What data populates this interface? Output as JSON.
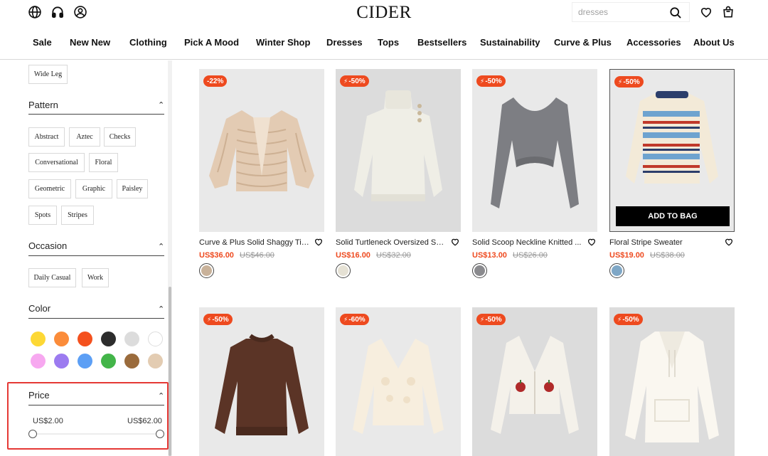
{
  "brand": {
    "logo": "CIDER"
  },
  "search": {
    "placeholder": "dresses"
  },
  "nav": [
    "Sale",
    "New New",
    "Clothing",
    "Pick A Mood",
    "Winter Shop",
    "Dresses",
    "Tops",
    "Bestsellers",
    "Sustainability",
    "Curve & Plus",
    "Accessories",
    "About Us"
  ],
  "filters": {
    "style_chip": "Wide Leg",
    "pattern": {
      "title": "Pattern",
      "options": [
        "Abstract",
        "Aztec",
        "Checks",
        "Conversational",
        "Floral",
        "Geometric",
        "Graphic",
        "Paisley",
        "Spots",
        "Stripes"
      ]
    },
    "occasion": {
      "title": "Occasion",
      "options": [
        "Daily Casual",
        "Work"
      ]
    },
    "color": {
      "title": "Color",
      "swatches": [
        "#fdd835",
        "#fb8c3a",
        "#f4511e",
        "#2d2d2d",
        "#dcdcdc",
        "#ffffff",
        "#f7a8f0",
        "#9c7bf0",
        "#5c9ff5",
        "#43b549",
        "#9a6b3c",
        "#e3ccb2"
      ]
    },
    "price": {
      "title": "Price",
      "min_label": "US$2.00",
      "max_label": "US$62.00",
      "selected_min": 2,
      "selected_max": 62
    }
  },
  "products": [
    {
      "name": "Curve & Plus Solid Shaggy Tie...",
      "price": "US$36.00",
      "old_price": "US$46.00",
      "badge": "-22%",
      "flash": false,
      "swatch": "#c9b29a"
    },
    {
      "name": "Solid Turtleneck Oversized Sw...",
      "price": "US$16.00",
      "old_price": "US$32.00",
      "badge": "-50%",
      "flash": true,
      "swatch": "#e5e1d4"
    },
    {
      "name": "Solid Scoop Neckline Knitted ...",
      "price": "US$13.00",
      "old_price": "US$26.00",
      "badge": "-50%",
      "flash": true,
      "swatch": "#8a8a8e"
    },
    {
      "name": "Floral Stripe Sweater",
      "price": "US$19.00",
      "old_price": "US$38.00",
      "badge": "-50%",
      "flash": true,
      "swatch": "#7fa7c6",
      "cta": "ADD TO BAG"
    },
    {
      "badge": "-50%",
      "flash": true
    },
    {
      "badge": "-60%",
      "flash": true
    },
    {
      "badge": "-50%",
      "flash": true
    },
    {
      "badge": "-50%",
      "flash": true
    }
  ]
}
